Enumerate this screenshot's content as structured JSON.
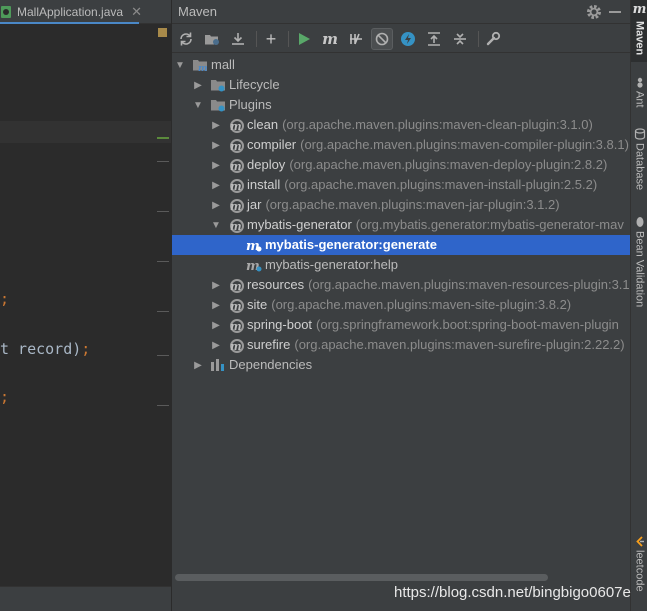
{
  "editor": {
    "tab_label": "MallApplication.java",
    "code_line_1": ";",
    "code_line_2_text": "t record)",
    "code_line_2_semi": ";",
    "code_line_3": ";"
  },
  "maven": {
    "title": "Maven",
    "toolbar": {
      "reload": "reload-icon",
      "generate_sources": "generate-sources-icon",
      "download": "download-icon",
      "add": "+",
      "run": "run-icon",
      "execute_goal": "m",
      "toggle_offline": "toggle-offline-icon",
      "skip_tests": "skip-tests-icon",
      "show_dependencies": "show-dependencies-icon",
      "collapse_all": "collapse-all-icon",
      "expand_all": "expand-all-icon",
      "settings": "wrench-icon"
    },
    "tree": {
      "project": "mall",
      "lifecycle": "Lifecycle",
      "plugins": "Plugins",
      "plugin_items": [
        {
          "name": "clean",
          "desc": "(org.apache.maven.plugins:maven-clean-plugin:3.1.0)"
        },
        {
          "name": "compiler",
          "desc": "(org.apache.maven.plugins:maven-compiler-plugin:3.8.1)"
        },
        {
          "name": "deploy",
          "desc": "(org.apache.maven.plugins:maven-deploy-plugin:2.8.2)"
        },
        {
          "name": "install",
          "desc": "(org.apache.maven.plugins:maven-install-plugin:2.5.2)"
        },
        {
          "name": "jar",
          "desc": "(org.apache.maven.plugins:maven-jar-plugin:3.1.2)"
        },
        {
          "name": "mybatis-generator",
          "desc": "(org.mybatis.generator:mybatis-generator-mav"
        }
      ],
      "goals": [
        {
          "name": "mybatis-generator:generate"
        },
        {
          "name": "mybatis-generator:help"
        }
      ],
      "plugin_items_after": [
        {
          "name": "resources",
          "desc": "(org.apache.maven.plugins:maven-resources-plugin:3.1"
        },
        {
          "name": "site",
          "desc": "(org.apache.maven.plugins:maven-site-plugin:3.8.2)"
        },
        {
          "name": "spring-boot",
          "desc": "(org.springframework.boot:spring-boot-maven-plugin"
        },
        {
          "name": "surefire",
          "desc": "(org.apache.maven.plugins:maven-surefire-plugin:2.22.2)"
        }
      ],
      "dependencies": "Dependencies"
    }
  },
  "side_stripe": {
    "maven_icon": "m",
    "maven": "Maven",
    "ant": "Ant",
    "database": "Database",
    "bean_validation": "Bean Validation",
    "leetcode": "leetcode"
  },
  "watermark": "https://blog.csdn.net/bingbigo0607e",
  "colors": {
    "selection": "#2f65ca",
    "panel": "#3c3f41",
    "editor": "#2b2b2b",
    "run_green": "#59a869",
    "accent_blue": "#3592c4"
  }
}
